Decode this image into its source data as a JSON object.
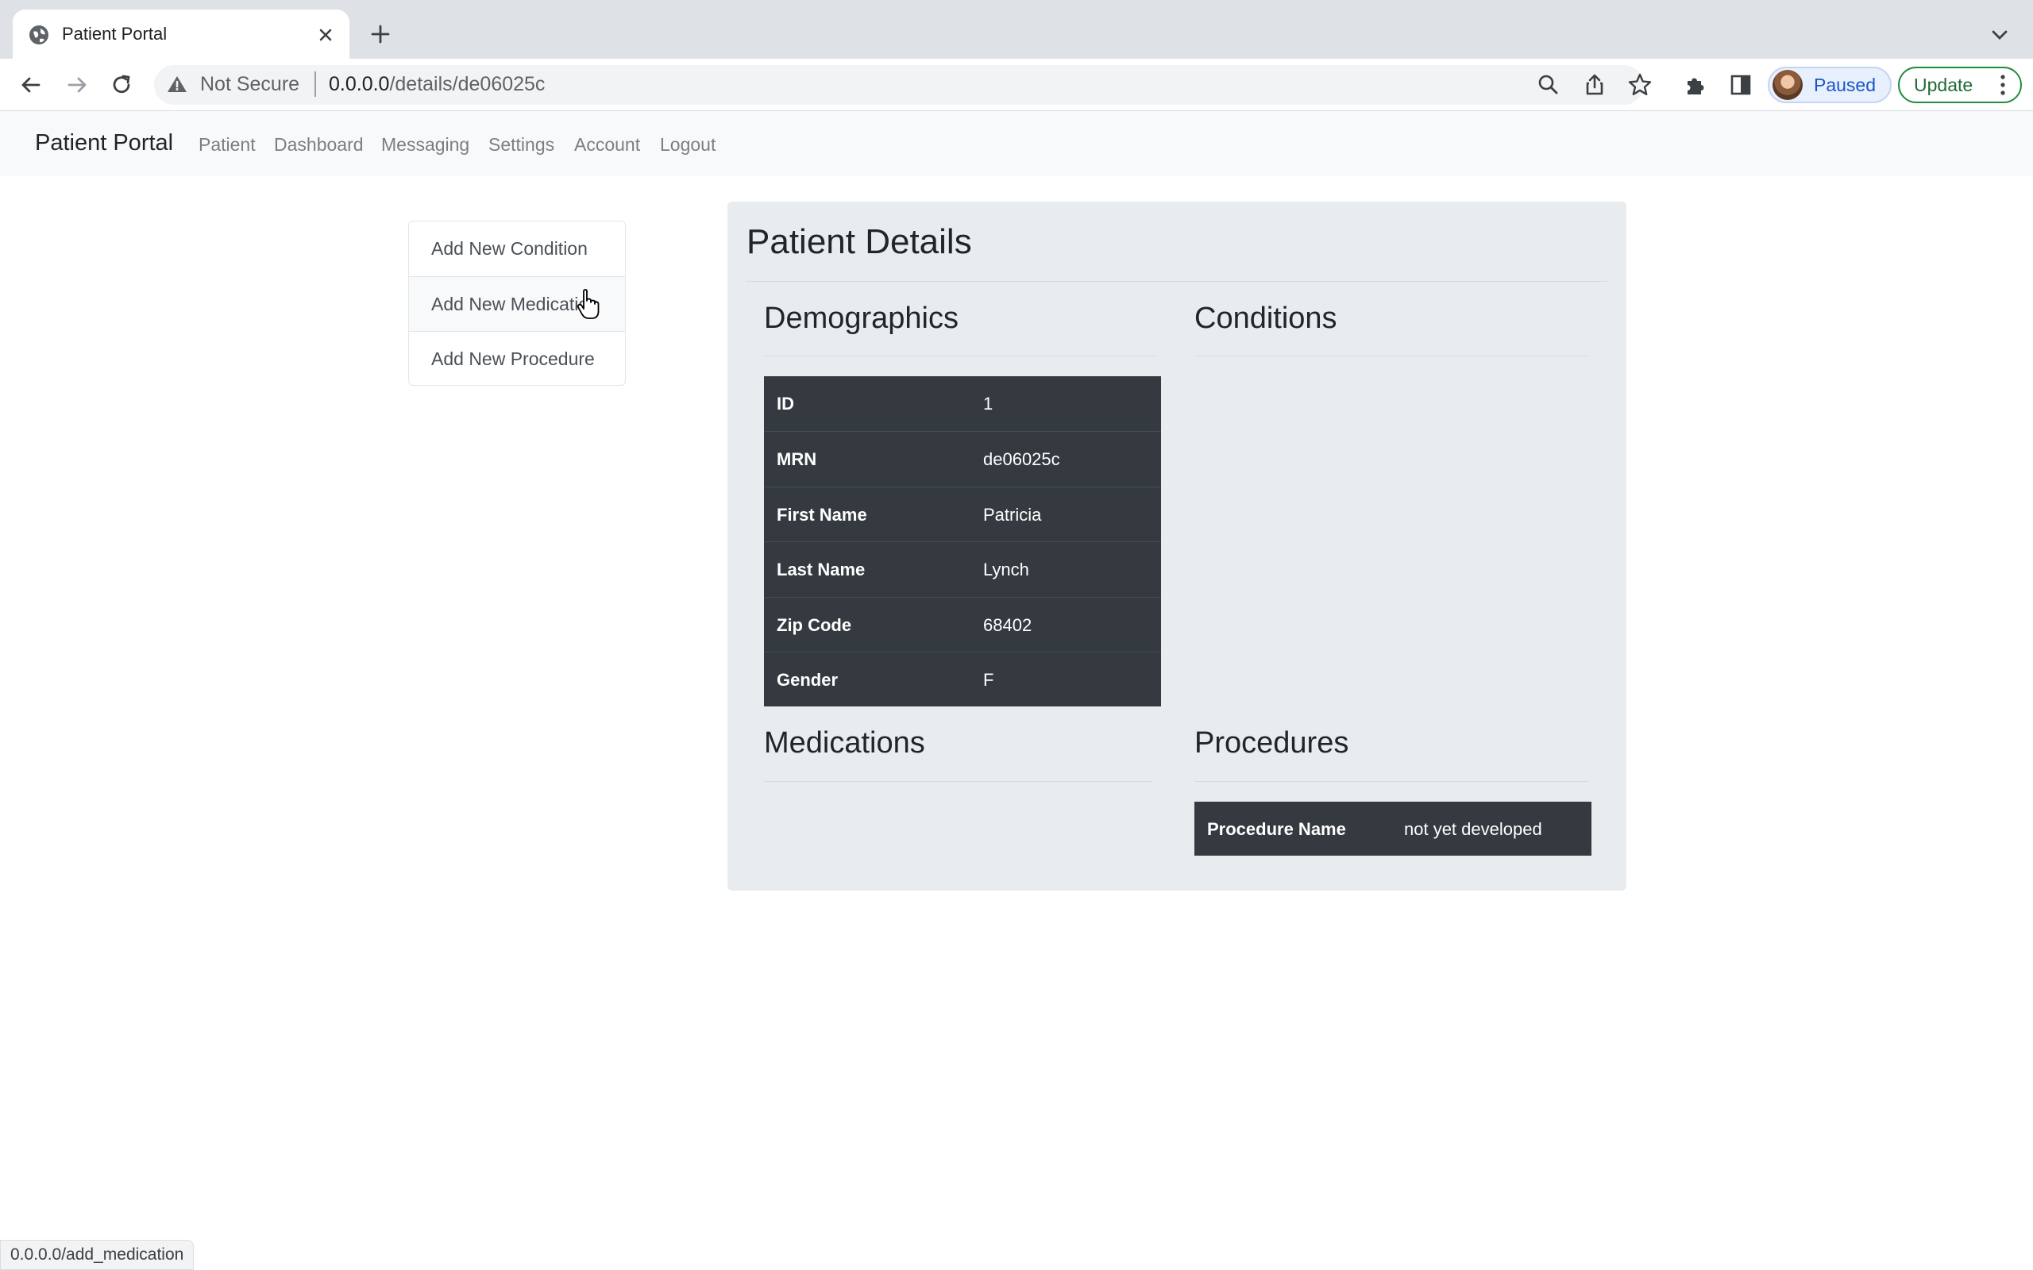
{
  "browser": {
    "tab_title": "Patient Portal",
    "security_label": "Not Secure",
    "url_host": "0.0.0.0",
    "url_path": "/details/de06025c",
    "profile_label": "Paused",
    "update_label": "Update",
    "status_url": "0.0.0.0/add_medication"
  },
  "navbar": {
    "brand": "Patient Portal",
    "links": [
      "Patient",
      "Dashboard",
      "Messaging",
      "Settings",
      "Account",
      "Logout"
    ]
  },
  "sidebar": {
    "items": [
      "Add New Condition",
      "Add New Medication",
      "Add New Procedure"
    ]
  },
  "details": {
    "title": "Patient Details",
    "demographics": {
      "title": "Demographics",
      "rows": [
        {
          "key": "ID",
          "value": "1"
        },
        {
          "key": "MRN",
          "value": "de06025c"
        },
        {
          "key": "First Name",
          "value": "Patricia"
        },
        {
          "key": "Last Name",
          "value": "Lynch"
        },
        {
          "key": "Zip Code",
          "value": "68402"
        },
        {
          "key": "Gender",
          "value": "F"
        }
      ]
    },
    "conditions": {
      "title": "Conditions"
    },
    "medications": {
      "title": "Medications"
    },
    "procedures": {
      "title": "Procedures",
      "rows": [
        {
          "key": "Procedure Name",
          "value": "not yet developed"
        }
      ]
    }
  }
}
